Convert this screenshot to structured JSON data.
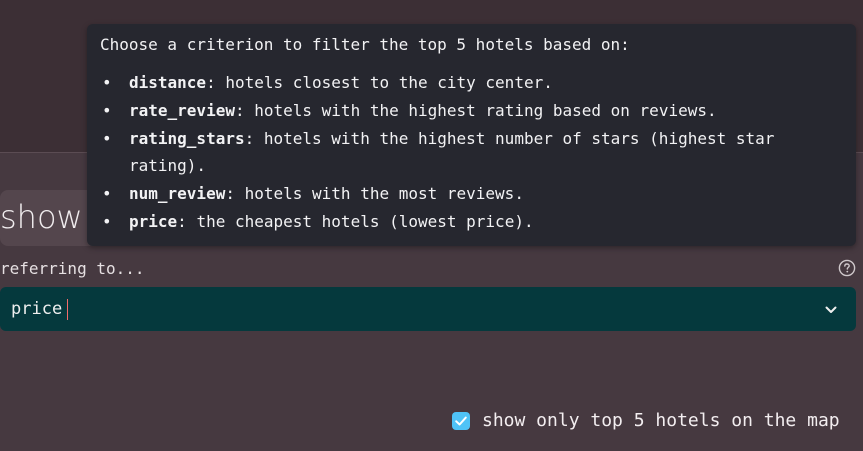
{
  "heading": {
    "show_text": "show"
  },
  "tooltip": {
    "intro": "Choose a criterion to filter the top 5 hotels based on:",
    "items": [
      {
        "term": "distance",
        "desc": ": hotels closest to the city center."
      },
      {
        "term": "rate_review",
        "desc": ": hotels with the highest rating based on reviews."
      },
      {
        "term": "rating_stars",
        "desc": ": hotels with the highest number of stars (highest star rating)."
      },
      {
        "term": "num_review",
        "desc": ": hotels with the most reviews."
      },
      {
        "term": "price",
        "desc": ": the cheapest hotels (lowest price)."
      }
    ]
  },
  "criterion": {
    "label": "referring to...",
    "help_icon": "question-circle-icon",
    "selected_value": "price",
    "chevron_icon": "chevron-down-icon"
  },
  "map_option": {
    "checked": true,
    "label": "show only top 5 hotels on the map"
  },
  "colors": {
    "background": "#463940",
    "top_band": "#3C2F35",
    "tooltip_bg": "#26272F",
    "select_bg": "#05393D",
    "caret": "#F26B6B",
    "checkbox": "#4FC3F7"
  }
}
